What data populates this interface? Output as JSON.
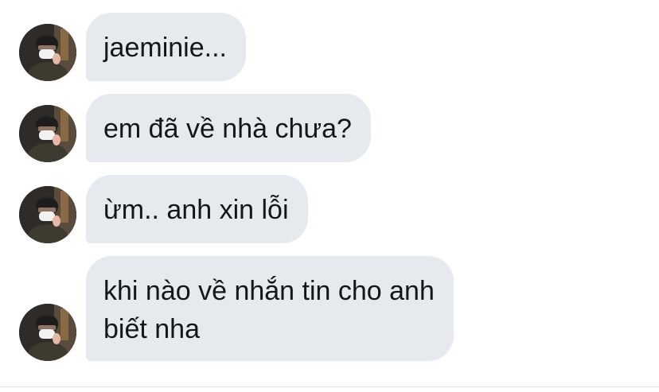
{
  "conversation": {
    "messages": [
      {
        "lines": [
          "jaeminie..."
        ]
      },
      {
        "lines": [
          "em đã về nhà chưa?"
        ]
      },
      {
        "lines": [
          "ừm.. anh xin lỗi"
        ]
      },
      {
        "lines": [
          "khi nào về nhắn tin cho anh",
          "biết nha"
        ]
      }
    ]
  },
  "colors": {
    "bubble_background": "#e6eaef",
    "text": "#14171a",
    "page_background": "#ffffff"
  },
  "icons": {
    "avatar": "profile-photo-avatar"
  }
}
